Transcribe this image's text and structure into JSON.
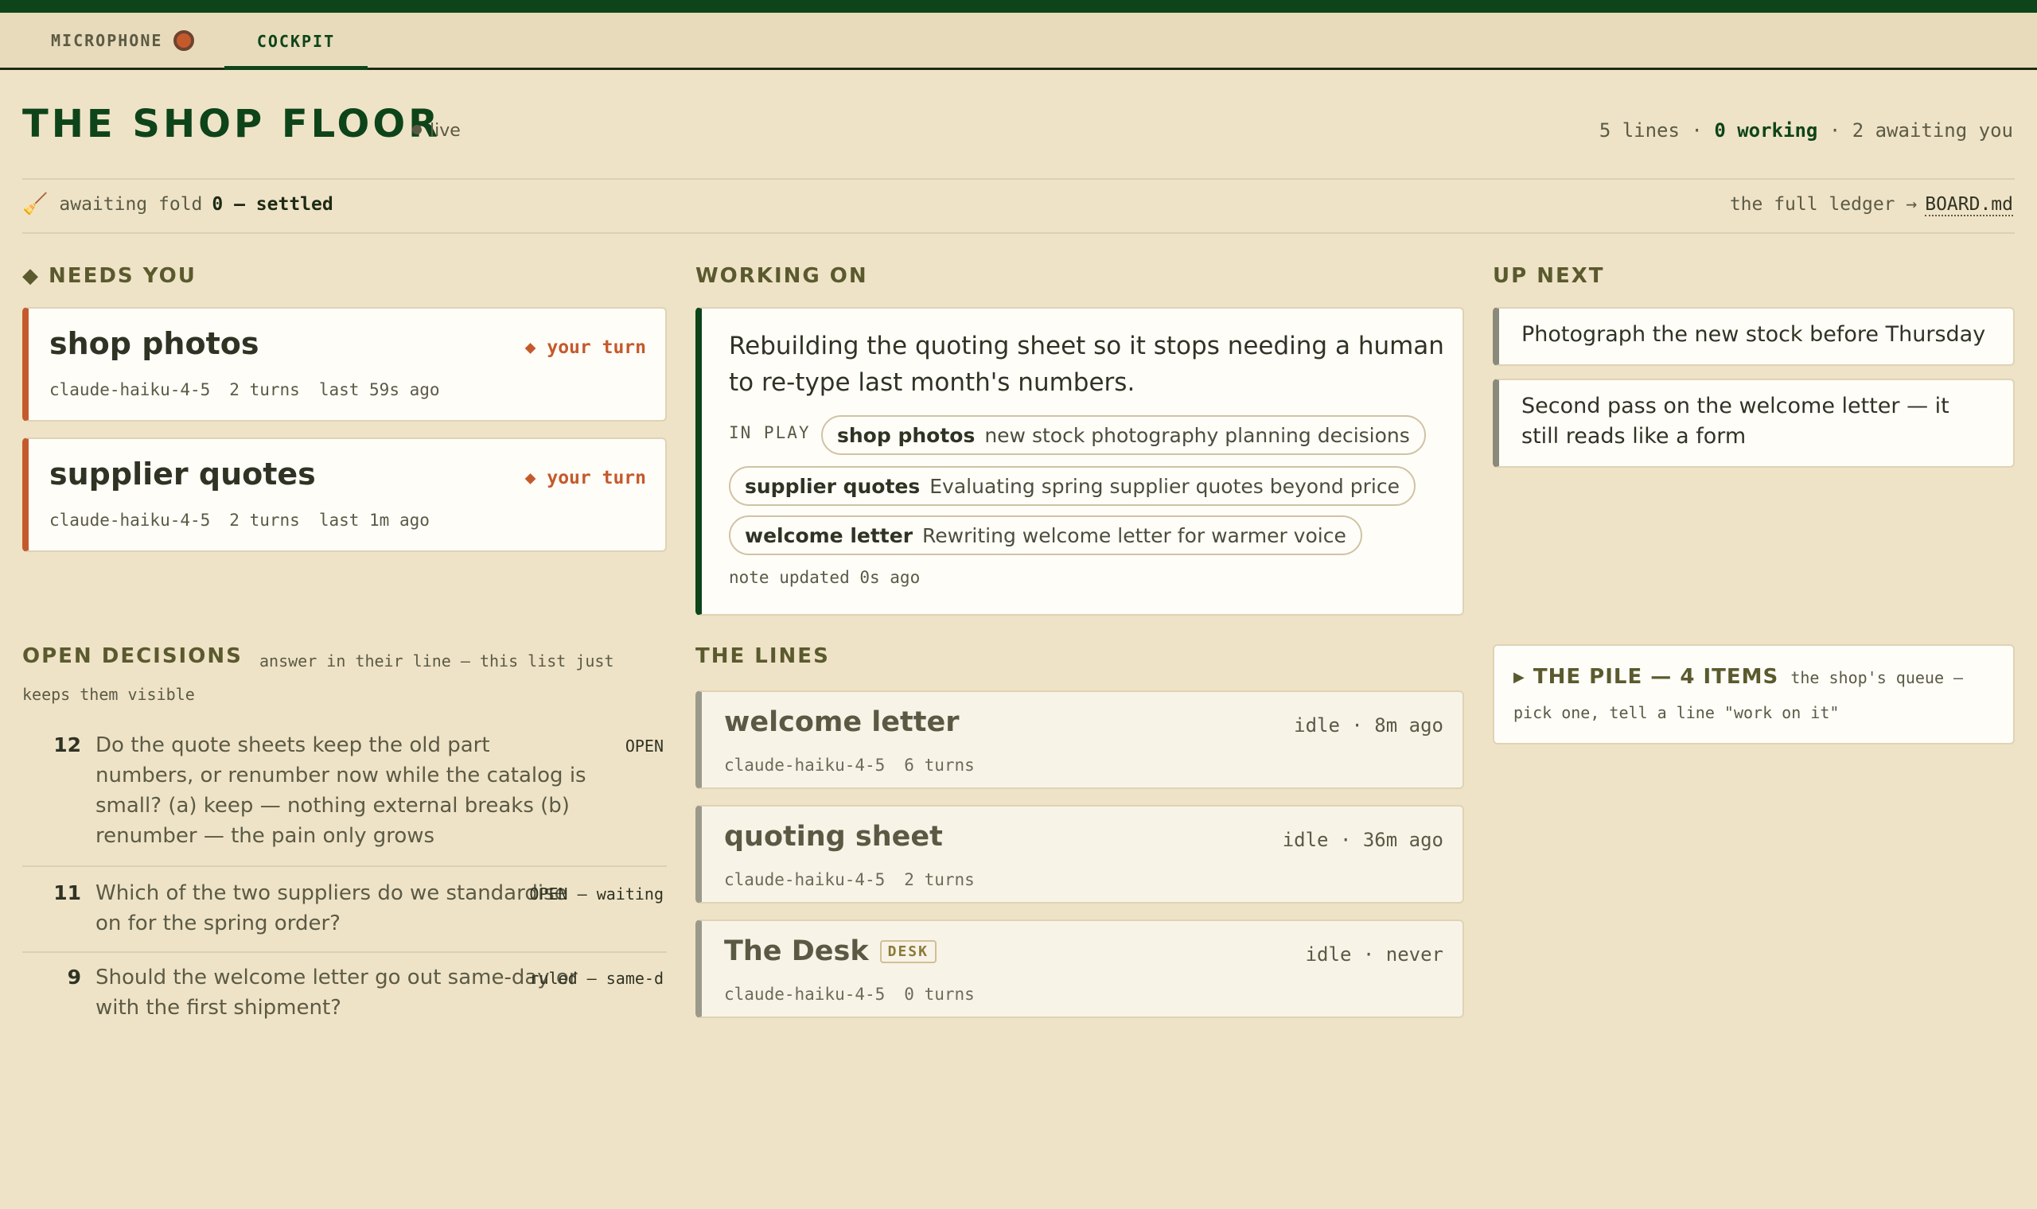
{
  "tabs": {
    "microphone": "MICROPHONE",
    "cockpit": "COCKPIT"
  },
  "header": {
    "title": "THE SHOP FLOOR",
    "live": "live",
    "stats_lines": "5 lines ·",
    "stats_working": "0 working",
    "stats_awaiting": "· 2 awaiting you"
  },
  "fold": {
    "label": "awaiting fold",
    "value": "0 — settled",
    "ledger_label": "the full ledger →",
    "ledger_link": "BOARD.md"
  },
  "needs_you": {
    "heading": "◆ NEEDS YOU",
    "items": [
      {
        "name": "shop photos",
        "turn": "◆ your turn",
        "model": "claude-haiku-4-5",
        "turns": "2 turns",
        "last": "last 59s ago"
      },
      {
        "name": "supplier quotes",
        "turn": "◆ your turn",
        "model": "claude-haiku-4-5",
        "turns": "2 turns",
        "last": "last 1m ago"
      }
    ]
  },
  "working_on": {
    "heading": "WORKING ON",
    "text": "Rebuilding the quoting sheet so it stops needing a human to re-type last month's numbers.",
    "in_play_label": "IN PLAY",
    "in_play": [
      {
        "name": "shop photos",
        "desc": "new stock photography planning decisions"
      },
      {
        "name": "supplier quotes",
        "desc": "Evaluating spring supplier quotes beyond price"
      },
      {
        "name": "welcome letter",
        "desc": "Rewriting welcome letter for warmer voice"
      }
    ],
    "note": "note updated 0s ago"
  },
  "up_next": {
    "heading": "UP NEXT",
    "items": [
      "Photograph the new stock before Thursday",
      "Second pass on the welcome letter — it still reads like a form"
    ]
  },
  "open_decisions": {
    "heading": "OPEN DECISIONS",
    "sub": "answer in their line — this list just keeps them visible",
    "items": [
      {
        "num": "12",
        "question": "Do the quote sheets keep the old part numbers, or renumber now while the catalog is small? (a) keep — nothing external breaks (b) renumber — the pain only grows",
        "status": "OPEN"
      },
      {
        "num": "11",
        "question": "Which of the two suppliers do we standardise on for the spring order?",
        "status": "OPEN — waiting"
      },
      {
        "num": "9",
        "question": "Should the welcome letter go out same-day or with the first shipment?",
        "status": "ruled — same-d"
      }
    ]
  },
  "lines": {
    "heading": "THE LINES",
    "items": [
      {
        "name": "welcome letter",
        "badge": "",
        "idle": "idle · 8m ago",
        "model": "claude-haiku-4-5",
        "turns": "6 turns"
      },
      {
        "name": "quoting sheet",
        "badge": "",
        "idle": "idle · 36m ago",
        "model": "claude-haiku-4-5",
        "turns": "2 turns"
      },
      {
        "name": "The Desk",
        "badge": "DESK",
        "idle": "idle · never",
        "model": "claude-haiku-4-5",
        "turns": "0 turns"
      }
    ]
  },
  "pile": {
    "heading": "THE PILE — 4 ITEMS",
    "sub": "the shop's queue — pick one, tell a line \"work on it\""
  },
  "colors": {
    "brand_green": "#0e4419",
    "accent_rust": "#c45a2c",
    "background": "#efe3c7"
  }
}
